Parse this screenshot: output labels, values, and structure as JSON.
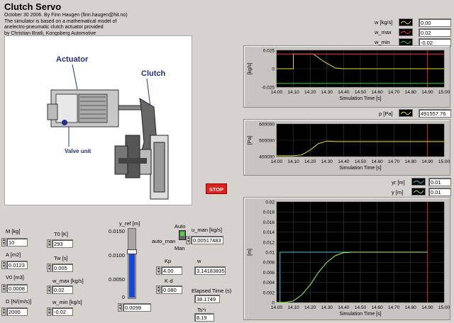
{
  "title": "Clutch Servo",
  "subtitle": "October 30 2006. By Finn Haugen (finn.haugen@hit.no)\nThe simulator is based on a mathematical model of\nanelectro-pneumatic clutch actuator provided\nby Christian Bratli, Kongsberg Automotive",
  "figure": {
    "actuator": "Actuator",
    "clutch": "Clutch",
    "valve": "Valve unit"
  },
  "legend_w": {
    "items": [
      {
        "label": "w [kg/s]",
        "value": "0.00",
        "color": "#e8e01a"
      },
      {
        "label": "w_max",
        "value": "0.02",
        "color": "#ff3030"
      },
      {
        "label": "w_min",
        "value": "-0.02",
        "color": "#20e020"
      }
    ]
  },
  "legend_p": {
    "label": "p [Pa]",
    "value": "491557.76",
    "color": "#e8e01a"
  },
  "legend_y": {
    "items": [
      {
        "label": "yr [m]",
        "value": "0.01",
        "color": "#30d0e8"
      },
      {
        "label": "y [m]",
        "value": "0.01",
        "color": "#a0ff40"
      }
    ]
  },
  "stop_label": "STOP",
  "params": [
    {
      "label": "M [kg]",
      "value": "10"
    },
    {
      "label": "A [m2]",
      "value": "0.0123"
    },
    {
      "label": "V0 [m3]",
      "value": "0.0008"
    },
    {
      "label": "D [N/(m/s)]",
      "value": "2000"
    }
  ],
  "params2": [
    {
      "label": "T0 [K]",
      "value": "293"
    },
    {
      "label": "Tw [s]",
      "value": "0.005"
    },
    {
      "label": "w_max [kg/s]",
      "value": "0.02"
    },
    {
      "label": "w_min [kg/s]",
      "value": "-0.02"
    }
  ],
  "slider": {
    "label": "y_ref [m]",
    "ticks": [
      "0.0150",
      "0.0100",
      "0.0050",
      "0"
    ],
    "value": "0.0099",
    "fraction": 0.66
  },
  "auto_man": {
    "label": "auto_man",
    "auto": "Auto",
    "man": "Man"
  },
  "u_man": {
    "label": "u_man [kg/s]",
    "value": "0.00517483"
  },
  "kp": {
    "label": "Kp",
    "value": "4.00"
  },
  "w": {
    "label": "w",
    "value": "3.14183835"
  },
  "kd": {
    "label": "K·d",
    "value": "0.080"
  },
  "elapsed": {
    "label": "Elapsed Time (s)",
    "value": "38.1749"
  },
  "ts": {
    "label": "Ts*i",
    "value": "8.19"
  },
  "chart_data": [
    {
      "type": "line",
      "xlabel": "Simulation Time [s]",
      "ylabel": "[kg/s]",
      "xlim": [
        14.0,
        15.0
      ],
      "ylim": [
        -0.025,
        0.025
      ],
      "yticks": [
        "0.025",
        "0",
        "-0.025"
      ],
      "xticks": [
        "14.00",
        "14.10",
        "14.20",
        "14.30",
        "14.40",
        "14.50",
        "14.60",
        "14.70",
        "14.80",
        "14.90",
        "15.00"
      ],
      "vline": 14.9,
      "series": [
        {
          "name": "w [kg/s]",
          "color": "#e8e01a",
          "x": [
            14.0,
            14.1,
            14.1,
            14.2,
            14.22,
            14.28,
            14.35,
            14.4,
            15.0
          ],
          "y": [
            0,
            0,
            0.02,
            0.02,
            0.02,
            0.01,
            0.001,
            0,
            0
          ]
        },
        {
          "name": "w_max",
          "color": "#ff3030",
          "x": [
            14.0,
            15.0
          ],
          "y": [
            0.02,
            0.02
          ]
        },
        {
          "name": "w_min",
          "color": "#20e020",
          "x": [
            14.0,
            15.0
          ],
          "y": [
            -0.02,
            -0.02
          ]
        }
      ]
    },
    {
      "type": "line",
      "xlabel": "Simulation Time [s]",
      "ylabel": "[Pa]",
      "xlim": [
        14.0,
        15.0
      ],
      "ylim": [
        400000,
        600000
      ],
      "yticks": [
        "600000",
        "500000",
        "400000"
      ],
      "xticks": [
        "14.00",
        "14.10",
        "14.20",
        "14.30",
        "14.40",
        "14.50",
        "14.60",
        "14.70",
        "14.80",
        "14.90",
        "15.00"
      ],
      "vline": 14.9,
      "series": [
        {
          "name": "p [Pa]",
          "color": "#e8e01a",
          "x": [
            14.0,
            14.1,
            14.15,
            14.2,
            14.25,
            14.3,
            14.35,
            15.0
          ],
          "y": [
            405000,
            405000,
            410000,
            440000,
            480000,
            495000,
            491557,
            491557
          ]
        }
      ]
    },
    {
      "type": "line",
      "xlabel": "Simulation Time [s]",
      "ylabel": "[m]",
      "xlim": [
        14.0,
        15.0
      ],
      "ylim": [
        0,
        0.02
      ],
      "yticks": [
        "0.02",
        "0.018",
        "0.016",
        "0.014",
        "0.012",
        "0.01",
        "0.008",
        "0.006",
        "0.004",
        "0.002",
        "0"
      ],
      "xticks": [
        "14.00",
        "14.10",
        "14.20",
        "14.30",
        "14.40",
        "14.50",
        "14.60",
        "14.70",
        "14.80",
        "14.90",
        "15.00"
      ],
      "vline": 14.9,
      "series": [
        {
          "name": "yr [m]",
          "color": "#30d0e8",
          "x": [
            14.0,
            14.02,
            14.02,
            14.9
          ],
          "y": [
            0,
            0,
            0.01,
            0.01
          ]
        },
        {
          "name": "y [m]",
          "color": "#a0ff40",
          "x": [
            14.0,
            14.05,
            14.1,
            14.15,
            14.2,
            14.25,
            14.3,
            14.35,
            14.4,
            14.45,
            14.9
          ],
          "y": [
            0,
            0,
            0.0003,
            0.0015,
            0.0035,
            0.006,
            0.008,
            0.0093,
            0.0099,
            0.01,
            0.01
          ]
        }
      ]
    }
  ]
}
